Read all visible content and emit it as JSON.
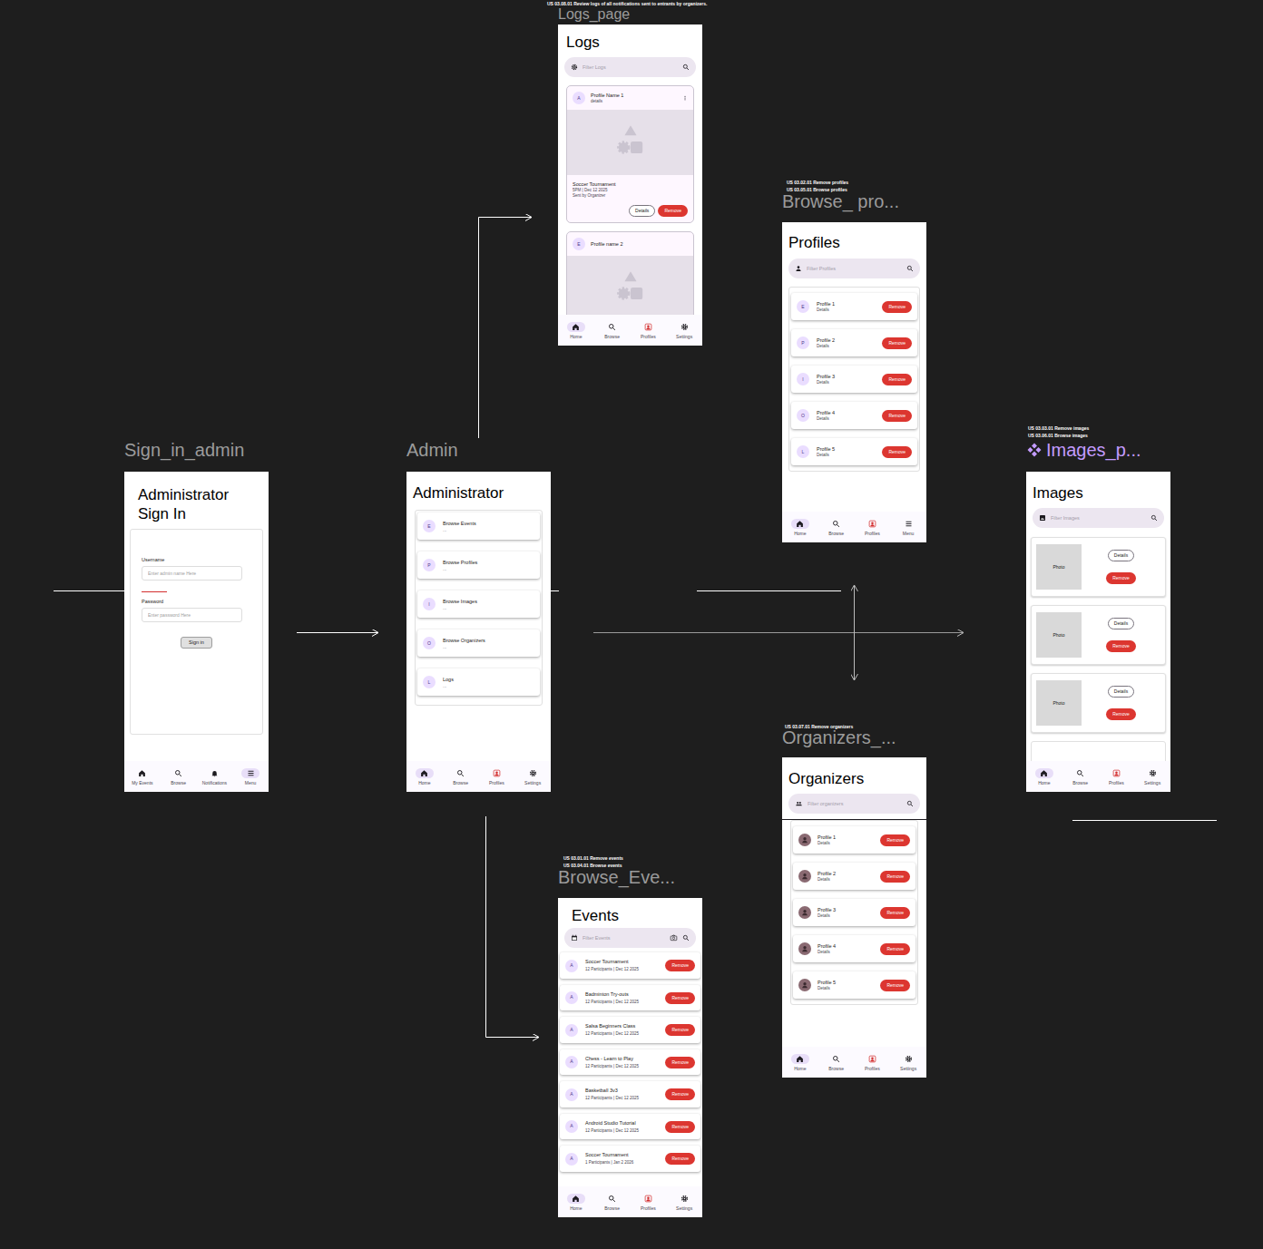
{
  "signin": {
    "label": "Sign_in_admin",
    "title": "Administrator Sign In",
    "username_label": "Username",
    "username_placeholder": "Enter admin name Here",
    "password_label": "Password",
    "password_placeholder": "Enter password Here",
    "button": "Sign in",
    "nav": [
      {
        "label": "My Events",
        "kind": "home",
        "selected": false
      },
      {
        "label": "Browse",
        "kind": "search",
        "selected": false
      },
      {
        "label": "Notifications",
        "kind": "bell",
        "selected": false
      },
      {
        "label": "Menu",
        "kind": "menu",
        "selected": true
      }
    ]
  },
  "admin": {
    "label": "Admin",
    "title": "Administrator",
    "items": [
      {
        "avatar": "E",
        "title": "Browse Events",
        "sub": "..."
      },
      {
        "avatar": "P",
        "title": "Browse Profiles",
        "sub": "..."
      },
      {
        "avatar": "I",
        "title": "Browse Images",
        "sub": "..."
      },
      {
        "avatar": "O",
        "title": "Browse Organizers",
        "sub": "..."
      },
      {
        "avatar": "L",
        "title": "Logs",
        "sub": "..."
      }
    ],
    "nav": [
      {
        "label": "Home",
        "kind": "home",
        "selected": true
      },
      {
        "label": "Browse",
        "kind": "search",
        "selected": false
      },
      {
        "label": "Profiles",
        "kind": "profile",
        "selected": false
      },
      {
        "label": "Settings",
        "kind": "settings",
        "selected": false
      }
    ]
  },
  "logs": {
    "notes": [
      "US 03.08.01 Review logs of all notifications sent to entrants by organizers."
    ],
    "label": "Logs_page",
    "title": "Logs",
    "placeholder": "Filter Logs",
    "cards": [
      {
        "avatar": "A",
        "name": "Profile Name 1",
        "sub": "details",
        "event": "Soccer Tournament",
        "time": "5PM |  Dec 12 2025",
        "sender": "Sent by Organizer",
        "details": "Details",
        "remove": "Remove"
      },
      {
        "avatar": "E",
        "name": "Profile name 2"
      }
    ],
    "nav": [
      {
        "label": "Home",
        "kind": "home",
        "selected": true
      },
      {
        "label": "Browse",
        "kind": "search",
        "selected": false
      },
      {
        "label": "Profiles",
        "kind": "profile",
        "selected": false
      },
      {
        "label": "Settings",
        "kind": "settings",
        "selected": false
      }
    ]
  },
  "profiles": {
    "notes": [
      "US 03.02.01 Remove profiles",
      "US 03.05.01 Browse profiles"
    ],
    "label": "Browse_ pro...",
    "title": "Profiles",
    "placeholder": "Filter Profiles",
    "items": [
      {
        "avatar": "E",
        "name": "Profile 1",
        "sub": "Details",
        "remove": "Remove"
      },
      {
        "avatar": "P",
        "name": "Profile 2",
        "sub": "Details",
        "remove": "Remove"
      },
      {
        "avatar": "I",
        "name": "Profile 3",
        "sub": "Details",
        "remove": "Remove"
      },
      {
        "avatar": "O",
        "name": "Profile 4",
        "sub": "Details",
        "remove": "Remove"
      },
      {
        "avatar": "L",
        "name": "Profile 5",
        "sub": "Details",
        "remove": "Remove"
      }
    ],
    "nav": [
      {
        "label": "Home",
        "kind": "home",
        "selected": true
      },
      {
        "label": "Browse",
        "kind": "search",
        "selected": false
      },
      {
        "label": "Profiles",
        "kind": "profile",
        "selected": false
      },
      {
        "label": "Menu",
        "kind": "menu",
        "selected": false
      }
    ]
  },
  "images": {
    "notes": [
      "US 03.03.01 Remove images",
      "US 03.06.01 Browse images"
    ],
    "label": "Images_p...",
    "title": "Images",
    "placeholder": "Filter Images",
    "items": [
      {
        "photo": "Photo",
        "details": "Details",
        "remove": "Remove"
      },
      {
        "photo": "Photo",
        "details": "Details",
        "remove": "Remove"
      },
      {
        "photo": "Photo",
        "details": "Details",
        "remove": "Remove"
      }
    ],
    "nav": [
      {
        "label": "Home",
        "kind": "home",
        "selected": true
      },
      {
        "label": "Browse",
        "kind": "search",
        "selected": false
      },
      {
        "label": "Profiles",
        "kind": "profile",
        "selected": false
      },
      {
        "label": "Settings",
        "kind": "settings",
        "selected": false
      }
    ]
  },
  "organizers": {
    "notes": [
      "US 03.07.01 Remove organizers"
    ],
    "label": "Organizers_...",
    "title": "Organizers",
    "placeholder": "Filter organizers",
    "items": [
      {
        "name": "Profile 1",
        "sub": "Details",
        "remove": "Remove"
      },
      {
        "name": "Profile 2",
        "sub": "Details",
        "remove": "Remove"
      },
      {
        "name": "Profile 3",
        "sub": "Details",
        "remove": "Remove"
      },
      {
        "name": "Profile 4",
        "sub": "Details",
        "remove": "Remove"
      },
      {
        "name": "Profile 5",
        "sub": "Details",
        "remove": "Remove"
      }
    ],
    "nav": [
      {
        "label": "Home",
        "kind": "home",
        "selected": true
      },
      {
        "label": "Browse",
        "kind": "search",
        "selected": false
      },
      {
        "label": "Profiles",
        "kind": "profile",
        "selected": false
      },
      {
        "label": "Settings",
        "kind": "settings",
        "selected": false
      }
    ]
  },
  "events": {
    "notes": [
      "US 03.01.01 Remove events",
      "US 03.04.01 Browse events"
    ],
    "label": "Browse_Eve...",
    "title": "Events",
    "placeholder": "Filter Events",
    "items": [
      {
        "avatar": "A",
        "title": "Soccer Tournament",
        "meta": "12 Participants | Dec 12 2025",
        "remove": "Remove"
      },
      {
        "avatar": "A",
        "title": "Badminton Try-outs",
        "meta": "12 Participants | Dec 12 2025",
        "remove": "Remove"
      },
      {
        "avatar": "A",
        "title": "Salsa Beginners Class",
        "meta": "12 Participants | Dec 12 2025",
        "remove": "Remove"
      },
      {
        "avatar": "A",
        "title": "Chess - Learn to Play",
        "meta": "12 Participants | Dec 12 2025",
        "remove": "Remove"
      },
      {
        "avatar": "A",
        "title": "Basketball 3v3",
        "meta": "12 Participants | Dec 12 2025",
        "remove": "Remove"
      },
      {
        "avatar": "A",
        "title": "Android Studio Tutorial",
        "meta": "12 Participants | Dec 12 2025",
        "remove": "Remove"
      },
      {
        "avatar": "A",
        "title": "Soccer Tournament",
        "meta": "1 Participants | Jan 2 2026",
        "remove": "Remove"
      }
    ],
    "nav": [
      {
        "label": "Home",
        "kind": "home",
        "selected": true
      },
      {
        "label": "Browse",
        "kind": "search",
        "selected": false
      },
      {
        "label": "Profiles",
        "kind": "profile",
        "selected": false
      },
      {
        "label": "Settings",
        "kind": "settings",
        "selected": false
      }
    ]
  }
}
